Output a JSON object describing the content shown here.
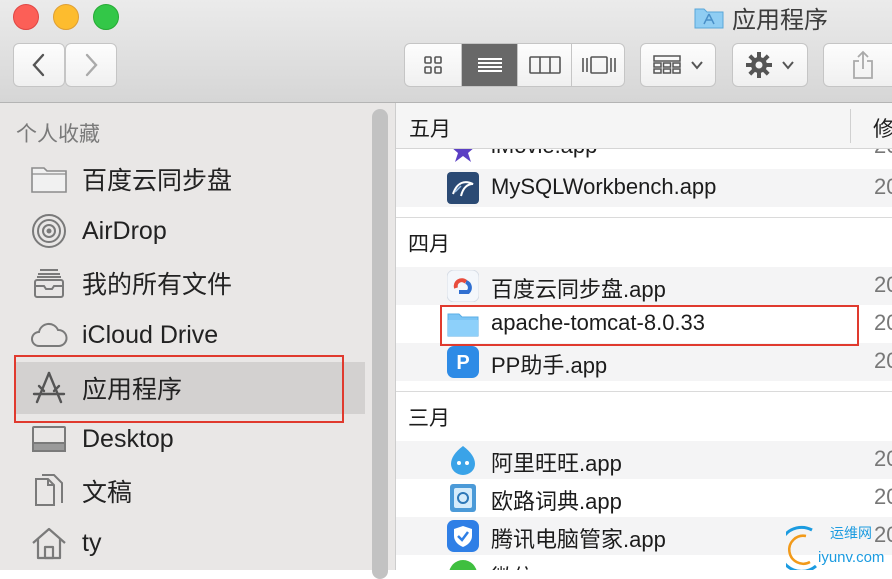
{
  "window": {
    "title": "应用程序"
  },
  "toolbar": {
    "back_icon": "chevron-left-icon",
    "forward_icon": "chevron-right-icon",
    "view_modes": [
      "icon-view-icon",
      "list-view-icon",
      "column-view-icon",
      "cover-flow-icon"
    ],
    "active_view": "list",
    "arrange_icon": "arrange-grid-icon",
    "action_icon": "gear-icon",
    "share_icon": "share-icon"
  },
  "sidebar": {
    "section_title": "个人收藏",
    "items": [
      {
        "label": "百度云同步盘",
        "icon": "folder-icon"
      },
      {
        "label": "AirDrop",
        "icon": "airdrop-icon"
      },
      {
        "label": "我的所有文件",
        "icon": "all-files-icon"
      },
      {
        "label": "iCloud Drive",
        "icon": "cloud-icon"
      },
      {
        "label": "应用程序",
        "icon": "applications-icon",
        "selected": true
      },
      {
        "label": "Desktop",
        "icon": "desktop-icon"
      },
      {
        "label": "文稿",
        "icon": "documents-icon"
      },
      {
        "label": "ty",
        "icon": "home-icon"
      }
    ]
  },
  "list": {
    "column_name": "五月",
    "column_modified": "修",
    "groups": [
      {
        "title": "四月"
      },
      {
        "title": "三月"
      }
    ],
    "rows": {
      "imovie": {
        "name": "iMovie.app",
        "date": "20"
      },
      "mysql": {
        "name": "MySQLWorkbench.app",
        "date": "20"
      },
      "baidu": {
        "name": "百度云同步盘.app",
        "date": "20"
      },
      "tomcat": {
        "name": "apache-tomcat-8.0.33",
        "date": "20"
      },
      "pp": {
        "name": "PP助手.app",
        "date": "20"
      },
      "aliwangwang": {
        "name": "阿里旺旺.app",
        "date": "20"
      },
      "oulu": {
        "name": "欧路词典.app",
        "date": "20"
      },
      "tencent": {
        "name": "腾讯电脑管家.app",
        "date": "20"
      },
      "wechat": {
        "name": "微信.app",
        "date": ""
      }
    }
  },
  "watermark": {
    "text1": "运维网",
    "text2": "iyunv.com"
  },
  "colors": {
    "highlight_box": "#e03a2e",
    "selection": "#d3d1d0",
    "folder_blue": "#7cc5f5"
  }
}
